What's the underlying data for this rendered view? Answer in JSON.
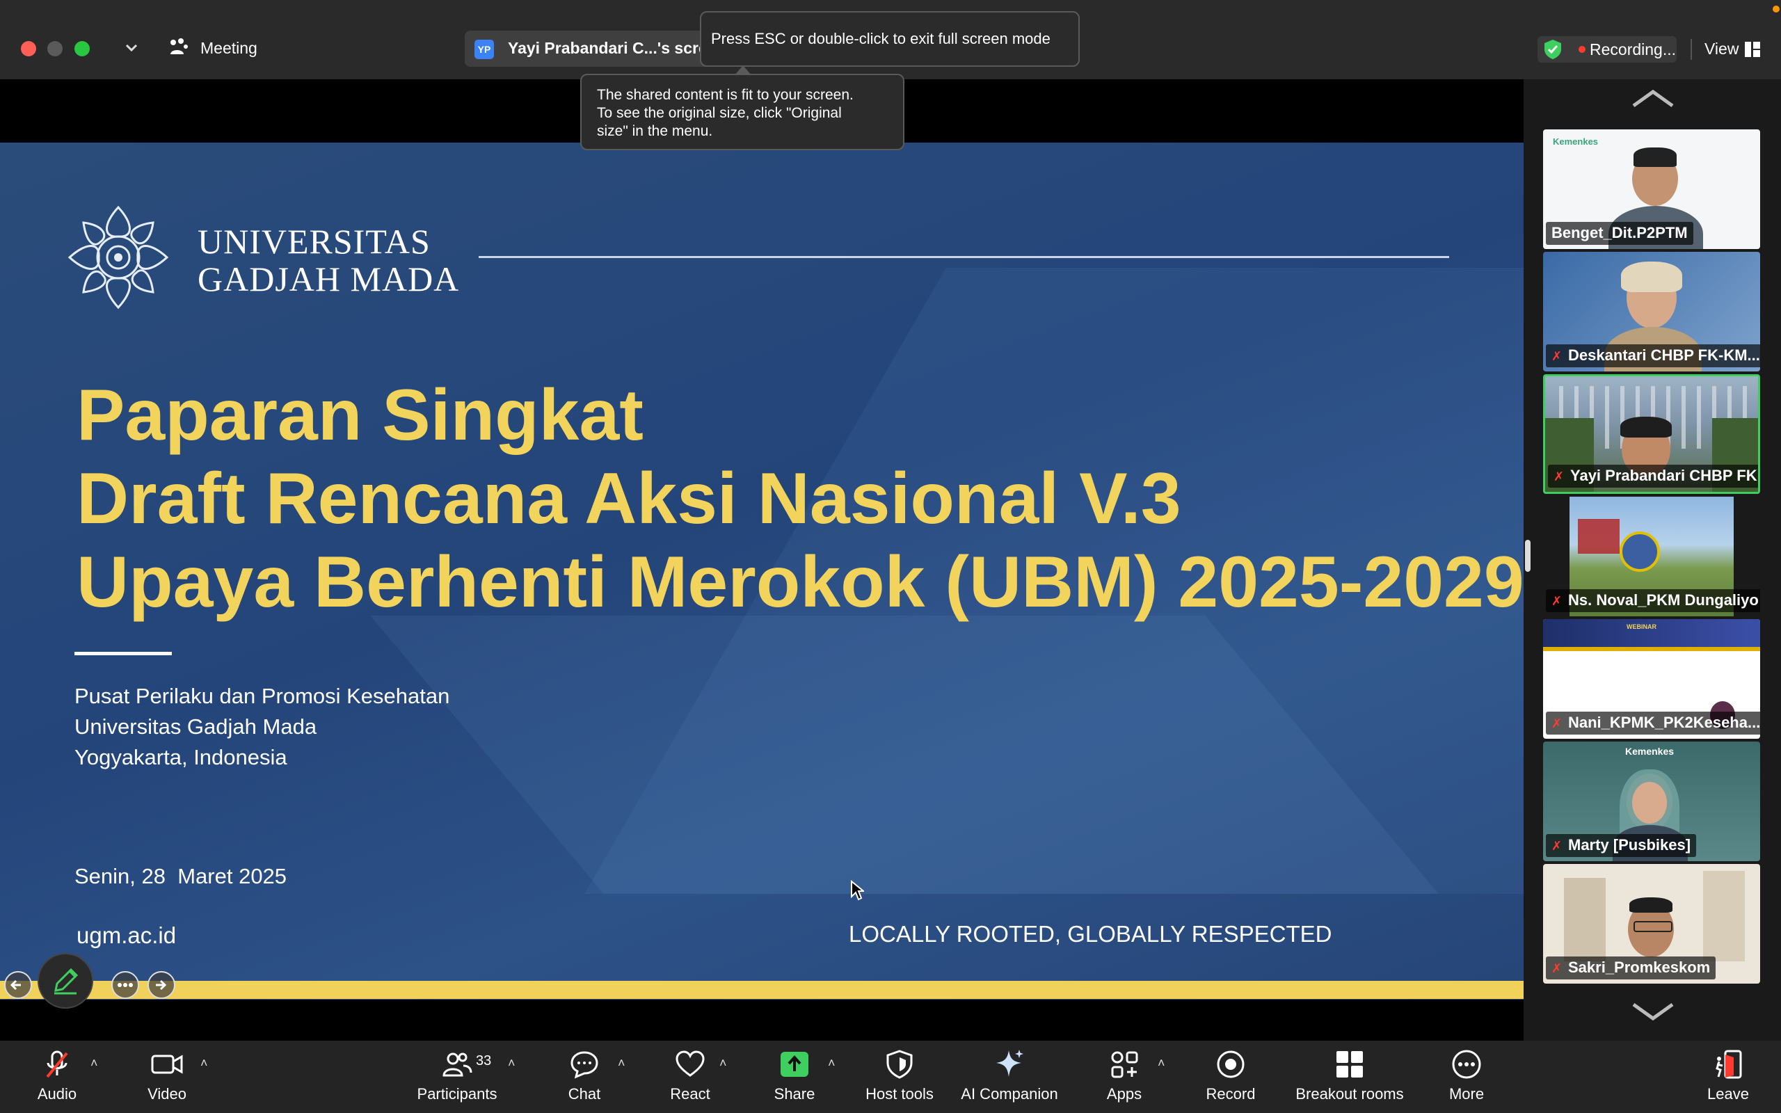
{
  "titlebar": {
    "meeting_label": "Meeting",
    "share_tab_initials": "YP",
    "share_tab_label": "Yayi Prabandari C...'s scree",
    "recording_label": "Recording...",
    "view_label": "View"
  },
  "tooltips": {
    "fullscreen": "Press ESC or double-click to exit full screen mode",
    "fit_line1": "The shared content is fit to your screen.",
    "fit_line2": "To see the original size, click \"Original",
    "fit_line3": "size\" in the menu."
  },
  "slide": {
    "university_line1": "UNIVERSITAS",
    "university_line2": "GADJAH MADA",
    "title_line1": "Paparan Singkat",
    "title_line2": "Draft Rencana Aksi Nasional V.3",
    "title_line3": "Upaya Berhenti Merokok (UBM) 2025-2029",
    "org_line1": "Pusat Perilaku dan Promosi Kesehatan",
    "org_line2": "Universitas Gadjah Mada",
    "org_line3": "Yogyakarta, Indonesia",
    "date": "Senin, 28  Maret 2025",
    "website": "ugm.ac.id",
    "tagline": "LOCALLY ROOTED, GLOBALLY RESPECTED"
  },
  "participants_tiles": [
    {
      "name": "Benget_Dit.P2PTM",
      "muted": false
    },
    {
      "name": "Deskantari CHBP FK-KM...",
      "muted": true
    },
    {
      "name": "Yayi Prabandari CHBP FK K...",
      "muted": true
    },
    {
      "name": "Ns. Noval_PKM Dungaliyo",
      "muted": true
    },
    {
      "name": "Nani_KPMK_PK2Keseha...",
      "muted": true
    },
    {
      "name": "Marty [Pusbikes]",
      "muted": true
    },
    {
      "name": "Sakri_Promkeskom",
      "muted": true
    }
  ],
  "tile_texts": {
    "kemenkes": "Kemenkes",
    "webinar": "WEBINAR"
  },
  "toolbar": {
    "audio": "Audio",
    "video": "Video",
    "participants": "Participants",
    "participants_count": "33",
    "chat": "Chat",
    "react": "React",
    "share": "Share",
    "host_tools": "Host tools",
    "ai_companion": "AI Companion",
    "apps": "Apps",
    "record": "Record",
    "breakout_rooms": "Breakout rooms",
    "more": "More",
    "leave": "Leave"
  },
  "colors": {
    "slide_title": "#f2d35b",
    "slide_bg": "#27497b",
    "share_green": "#3ecf5e",
    "active_border": "#3ecf5e",
    "recording_red": "#ff3b30"
  }
}
